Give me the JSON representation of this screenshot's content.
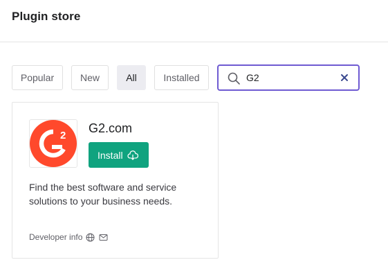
{
  "header": {
    "title": "Plugin store"
  },
  "filters": [
    {
      "label": "Popular",
      "active": false
    },
    {
      "label": "New",
      "active": false
    },
    {
      "label": "All",
      "active": true
    },
    {
      "label": "Installed",
      "active": false
    }
  ],
  "search": {
    "value": "G2",
    "placeholder": ""
  },
  "colors": {
    "accent": "#6e5ad2",
    "install_green": "#10a37f",
    "logo_red": "#ff492c"
  },
  "plugin": {
    "name": "G2.com",
    "install_label": "Install",
    "description": "Find the best software and service solutions to your business needs.",
    "developer_info_label": "Developer info",
    "logo_icon": "g2-logo-icon",
    "developer_icons": [
      "globe-icon",
      "mail-icon"
    ]
  }
}
